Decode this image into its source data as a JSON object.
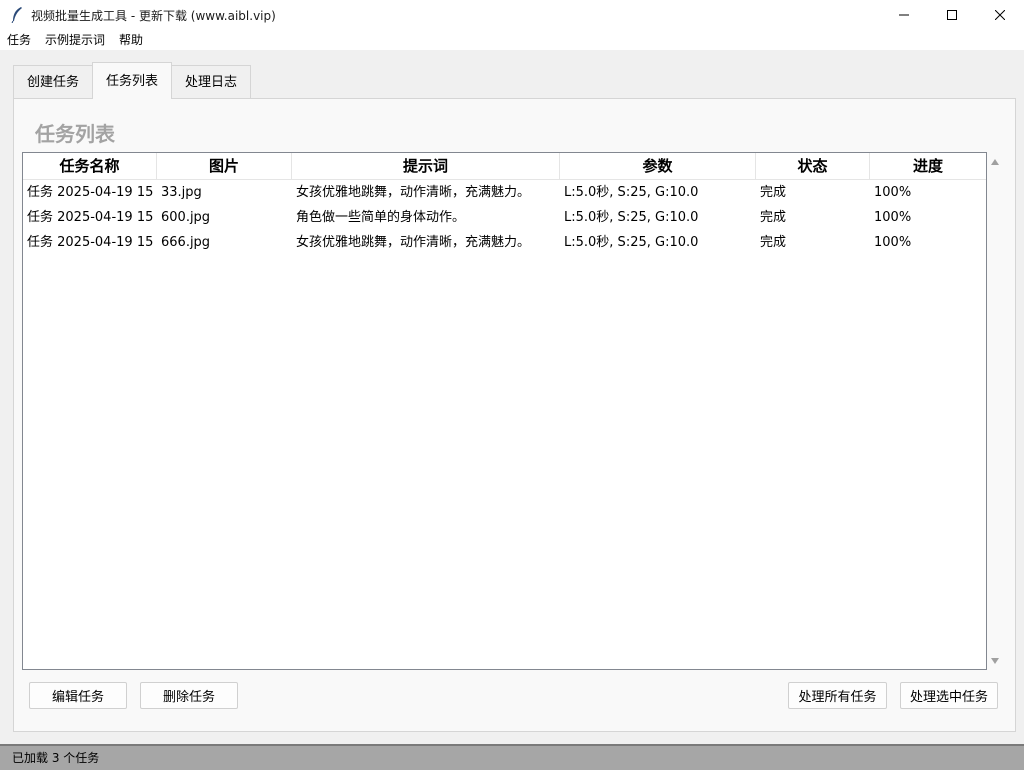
{
  "window": {
    "title": "视频批量生成工具 - 更新下载 (www.aibl.vip)"
  },
  "menu": {
    "items": [
      "任务",
      "示例提示词",
      "帮助"
    ]
  },
  "tabs": [
    {
      "label": "创建任务",
      "active": false
    },
    {
      "label": "任务列表",
      "active": true
    },
    {
      "label": "处理日志",
      "active": false
    }
  ],
  "panel": {
    "title": "任务列表"
  },
  "table": {
    "columns": [
      "任务名称",
      "图片",
      "提示词",
      "参数",
      "状态",
      "进度"
    ],
    "rows": [
      [
        "任务 2025-04-19 15",
        "33.jpg",
        "女孩优雅地跳舞，动作清晰，充满魅力。",
        "L:5.0秒, S:25, G:10.0",
        "完成",
        "100%"
      ],
      [
        "任务 2025-04-19 15",
        "600.jpg",
        "角色做一些简单的身体动作。",
        "L:5.0秒, S:25, G:10.0",
        "完成",
        "100%"
      ],
      [
        "任务 2025-04-19 15",
        "666.jpg",
        "女孩优雅地跳舞，动作清晰，充满魅力。",
        "L:5.0秒, S:25, G:10.0",
        "完成",
        "100%"
      ]
    ]
  },
  "buttons": {
    "edit": "编辑任务",
    "delete": "删除任务",
    "process_all": "处理所有任务",
    "process_selected": "处理选中任务"
  },
  "status": {
    "text": "已加载 3 个任务"
  },
  "icons": {
    "app": "feather-icon",
    "minimize": "minimize-icon",
    "maximize": "maximize-icon",
    "close": "close-icon"
  }
}
